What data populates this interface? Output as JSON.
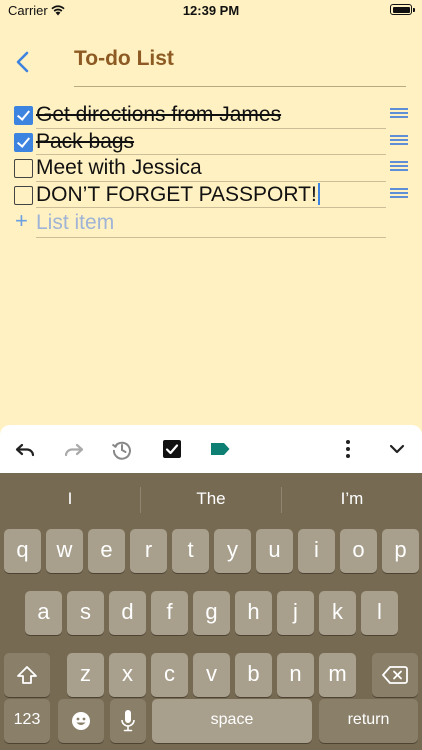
{
  "status": {
    "carrier": "Carrier",
    "time": "12:39 PM",
    "battery_level": 1.0
  },
  "header": {
    "title": "To-do List"
  },
  "list": {
    "items": [
      {
        "label": "Get directions from James",
        "checked": true
      },
      {
        "label": "Pack bags",
        "checked": true
      },
      {
        "label": "Meet with Jessica",
        "checked": false
      },
      {
        "label": "DON’T FORGET PASSPORT!",
        "checked": false
      }
    ],
    "add_placeholder": "List item",
    "add_symbol": "+"
  },
  "toolbar": {
    "icons": [
      "undo-icon",
      "redo-icon",
      "history-icon",
      "checkbox-icon",
      "label-tag-icon",
      "more-vertical-icon",
      "chevron-down-icon"
    ],
    "tag_color": "#0E7F73"
  },
  "keyboard": {
    "suggestions": [
      "I",
      "The",
      "I’m"
    ],
    "row1": [
      "q",
      "w",
      "e",
      "r",
      "t",
      "y",
      "u",
      "i",
      "o",
      "p"
    ],
    "row2": [
      "a",
      "s",
      "d",
      "f",
      "g",
      "h",
      "j",
      "k",
      "l"
    ],
    "row3": [
      "z",
      "x",
      "c",
      "v",
      "b",
      "n",
      "m"
    ],
    "numbers_label": "123",
    "space_label": "space",
    "return_label": "return"
  },
  "colors": {
    "background": "#FFF1C2",
    "title": "#8C5A22",
    "accent": "#3D83E0",
    "keyboard_bg": "#766A53"
  }
}
